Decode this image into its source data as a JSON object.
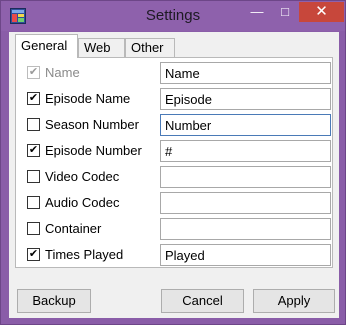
{
  "window": {
    "title": "Settings",
    "min_icon": "minimize-icon",
    "max_icon": "maximize-icon",
    "close_icon": "close-icon",
    "close_color": "#c7473b",
    "frame_color": "#8a5da8"
  },
  "tabs": [
    {
      "label": "General",
      "active": true
    },
    {
      "label": "Web",
      "active": false
    },
    {
      "label": "Other",
      "active": false
    }
  ],
  "rows": [
    {
      "label": "Name",
      "checked": true,
      "enabled": false,
      "value": "Name"
    },
    {
      "label": "Episode Name",
      "checked": true,
      "enabled": true,
      "value": "Episode"
    },
    {
      "label": "Season Number",
      "checked": false,
      "enabled": true,
      "value": "Number"
    },
    {
      "label": "Episode Number",
      "checked": true,
      "enabled": true,
      "value": "#"
    },
    {
      "label": "Video Codec",
      "checked": false,
      "enabled": true,
      "value": ""
    },
    {
      "label": "Audio Codec",
      "checked": false,
      "enabled": true,
      "value": ""
    },
    {
      "label": "Container",
      "checked": false,
      "enabled": true,
      "value": ""
    },
    {
      "label": "Times Played",
      "checked": true,
      "enabled": true,
      "value": "Played"
    }
  ],
  "buttons": {
    "backup": "Backup",
    "cancel": "Cancel",
    "apply": "Apply"
  }
}
